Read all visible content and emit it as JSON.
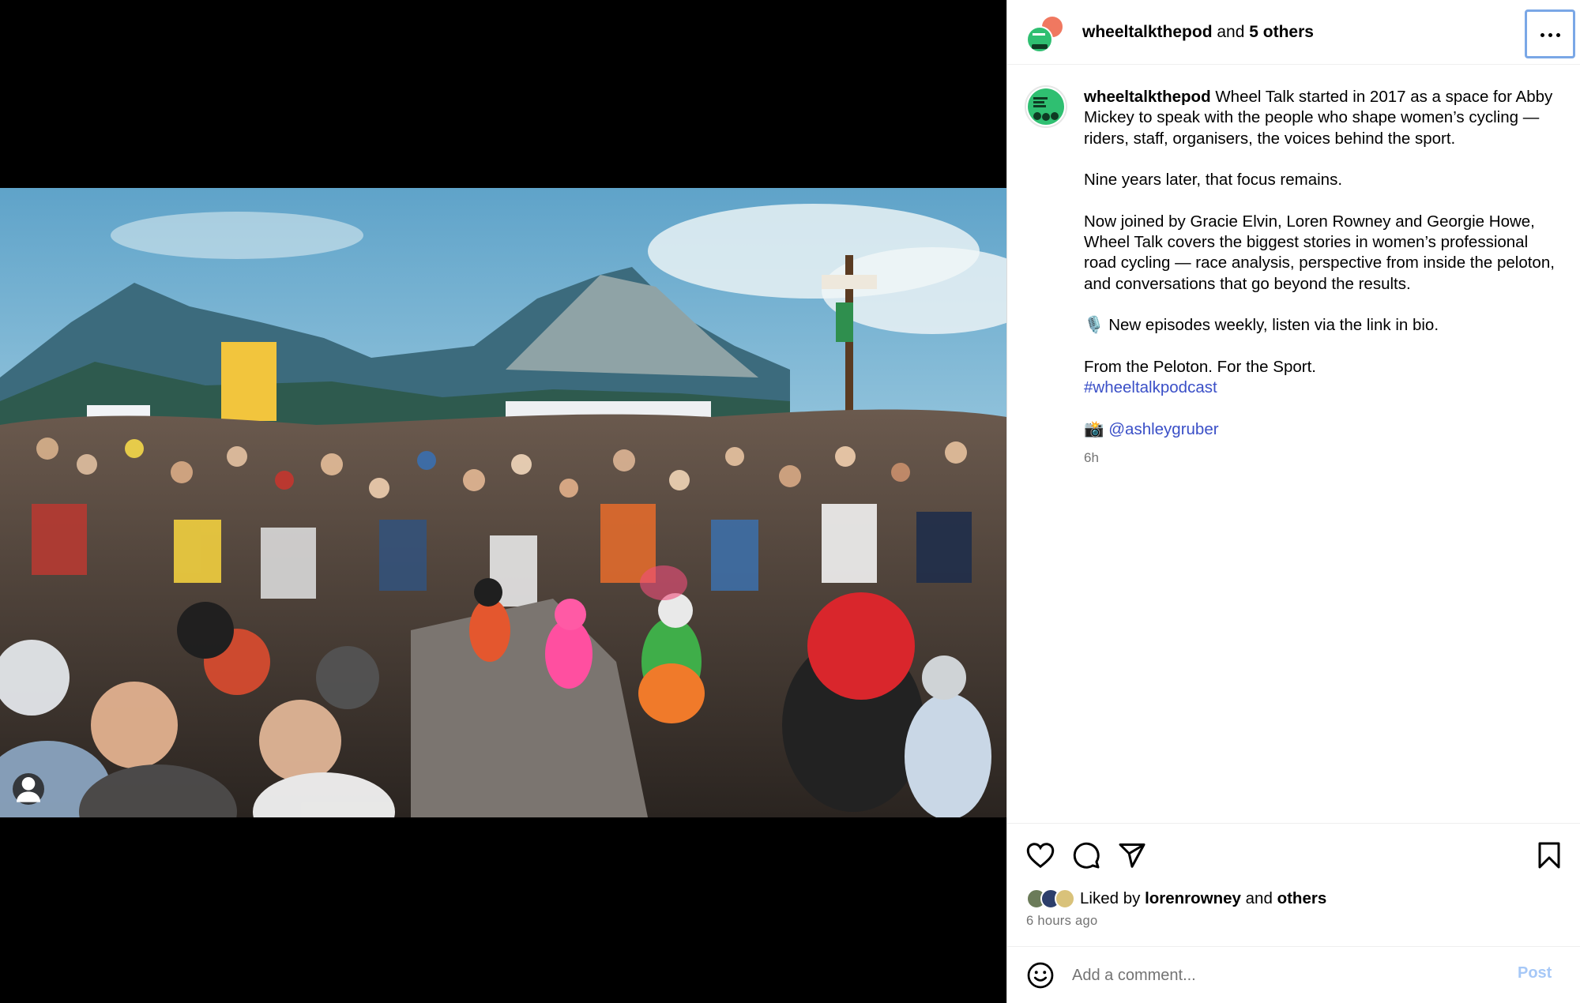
{
  "post": {
    "author": "wheeltalkthepod",
    "collab_connector": "and",
    "collab_others": "5 others",
    "caption_username": "wheeltalkthepod",
    "caption_lines": {
      "p1": "Wheel Talk started in 2017 as a space for Abby Mickey to speak with the people who shape women’s cycling — riders, staff, organisers, the voices behind the sport.",
      "p2": "Nine years later, that focus remains.",
      "p3": "Now joined by Gracie Elvin, Loren Rowney and Georgie Howe, Wheel Talk covers the biggest stories in women’s professional road cycling — race analysis, perspective from inside the peloton, and conversations that go beyond the results.",
      "p4": "🎙️ New episodes weekly, listen via the link in bio.",
      "p5": "From the Peloton. For the Sport.",
      "hashtag": "#wheeltalkpodcast",
      "photo_credit_emoji": "📸",
      "photo_credit_handle": "@ashleygruber"
    },
    "caption_age": "6h"
  },
  "likes": {
    "prefix": "Liked by",
    "first_liker": "lorenrowney",
    "connector": "and",
    "others": "others",
    "timestamp": "6 hours ago"
  },
  "comment": {
    "placeholder": "Add a comment...",
    "post_label": "Post"
  },
  "icons": {
    "more": "more-options-icon",
    "like": "heart-icon",
    "comment": "comment-bubble-icon",
    "share": "paper-plane-icon",
    "save": "bookmark-icon",
    "emoji": "smiley-icon",
    "tag": "user-tag-icon"
  },
  "colors": {
    "link": "#3a4fc7",
    "muted": "#737373",
    "post_button_disabled": "#a6c8f7",
    "focus_ring": "#7aa7e6",
    "avatar_green": "#2fbf71",
    "avatar_coral": "#f07860"
  }
}
